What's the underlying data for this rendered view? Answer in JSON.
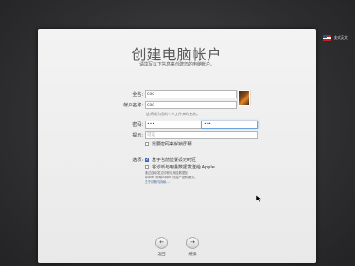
{
  "menubar": {
    "input_source": "美式英文"
  },
  "panel": {
    "title": "创建电脑帐户",
    "subtitle": "请填写以下信息来创建您的电脑帐户。"
  },
  "form": {
    "full_name_label": "全名:",
    "full_name_value": "coo",
    "account_name_label": "帐户名称:",
    "account_name_value": "coo",
    "account_name_hint": "这将成为您的个人文件夹的名称。",
    "password_label": "密码:",
    "password_value": "•••",
    "verify_value": "•••",
    "hint_label": "提示:",
    "hint_placeholder": "可选",
    "screen_lock_label": "需要密码来解锁屏幕",
    "options_label": "选项:",
    "opt_timezone_label": "基于当前位置设定时区",
    "opt_diagnostics_label": "将诊断与用量数据发送给 Apple",
    "diag_note_line1": "通过自动发送诊断与用量数据至",
    "diag_note_line2": "Apple, 帮助 Apple 改善产品和服务。",
    "about_link": "关于诊断与隐私..."
  },
  "nav": {
    "back_label": "返回",
    "continue_label": "继续",
    "back_icon": "←",
    "continue_icon": "→"
  }
}
